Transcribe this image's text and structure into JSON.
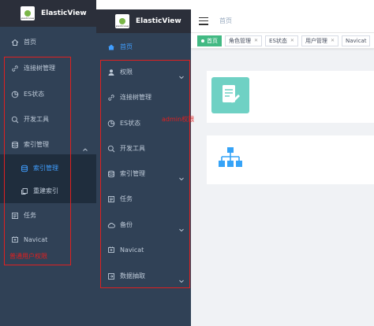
{
  "left_sidebar": {
    "app_title": "ElasticView",
    "logo_caption": "elasticview",
    "items": [
      {
        "label": "首页",
        "icon": "home-icon"
      },
      {
        "label": "连接树管理",
        "icon": "link-icon"
      },
      {
        "label": "ES状态",
        "icon": "pie-icon"
      },
      {
        "label": "开发工具",
        "icon": "search-icon"
      },
      {
        "label": "索引管理",
        "icon": "database-icon"
      },
      {
        "label": "索引管理",
        "icon": "database-icon"
      },
      {
        "label": "重建索引",
        "icon": "copy-icon"
      },
      {
        "label": "任务",
        "icon": "list-icon"
      },
      {
        "label": "Navicat",
        "icon": "plugin-icon"
      }
    ],
    "annotation": "普通用户权限"
  },
  "right_sidebar": {
    "app_title": "ElasticView",
    "logo_caption": "elasticview",
    "items": [
      {
        "label": "首页",
        "icon": "home-icon"
      },
      {
        "label": "权限",
        "icon": "user-icon"
      },
      {
        "label": "连接树管理",
        "icon": "link-icon"
      },
      {
        "label": "ES状态",
        "icon": "pie-icon"
      },
      {
        "label": "开发工具",
        "icon": "search-icon"
      },
      {
        "label": "索引管理",
        "icon": "database-icon"
      },
      {
        "label": "任务",
        "icon": "list-icon"
      },
      {
        "label": "备份",
        "icon": "cloud-icon"
      },
      {
        "label": "Navicat",
        "icon": "plugin-icon"
      },
      {
        "label": "数据抽取",
        "icon": "export-icon"
      }
    ],
    "annotation": "admin权限"
  },
  "topbar": {
    "breadcrumb": "首页"
  },
  "tags": [
    {
      "label": "首页",
      "active": true
    },
    {
      "label": "角色管理",
      "active": false
    },
    {
      "label": "ES状态",
      "active": false
    },
    {
      "label": "用户管理",
      "active": false
    },
    {
      "label": "Navicat",
      "active": false
    }
  ],
  "colors": {
    "sidebar_bg": "#304156",
    "sidebar_text": "#bfcbd9",
    "active_text": "#409eff",
    "active_tag": "#42b983",
    "annotation": "#e02020",
    "card_icon_teal": "#6fd1c4",
    "card_icon_blue": "#36a3f7"
  }
}
